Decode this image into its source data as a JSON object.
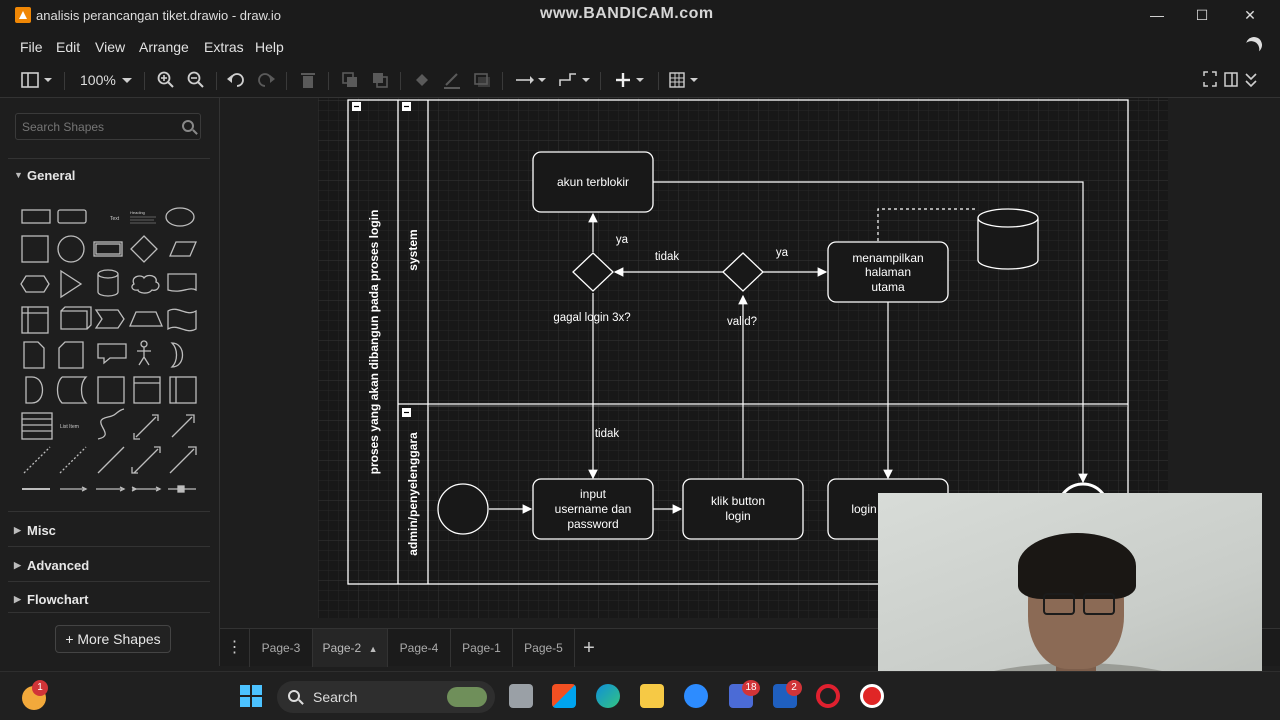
{
  "window": {
    "title": "analisis perancangan tiket.drawio - draw.io",
    "watermark": "www.BANDICAM.com",
    "controls": [
      "—",
      "☐",
      "✕"
    ]
  },
  "menu": [
    "File",
    "Edit",
    "View",
    "Arrange",
    "Extras",
    "Help"
  ],
  "toolbar": {
    "zoom": "100%"
  },
  "sidebar": {
    "search_placeholder": "Search Shapes",
    "sections": [
      "General",
      "Misc",
      "Advanced",
      "Flowchart"
    ],
    "more_shapes": "+ More Shapes",
    "shape_labels": {
      "text": "Text",
      "heading": "Heading",
      "list_item": "List Item"
    }
  },
  "diagram": {
    "pool_title": "proses yang akan dibangun pada proses login",
    "lane_system": "system",
    "lane_admin": "admin/penyelenggara",
    "nodes": {
      "akun_terblokir": "akun terblokir",
      "menampilkan": [
        "menampilkan",
        "halaman",
        "utama"
      ],
      "input": [
        "input",
        "username dan",
        "password"
      ],
      "klik": [
        "klik button",
        "login"
      ],
      "login": "login"
    },
    "labels": {
      "ya1": "ya",
      "tidak1": "tidak",
      "ya2": "ya",
      "gagal": "gagal login 3x?",
      "valid": "valid?",
      "tidak2": "tidak"
    }
  },
  "pages": [
    "Page-3",
    "Page-2",
    "Page-4",
    "Page-1",
    "Page-5"
  ],
  "taskbar": {
    "search": "Search",
    "badges": {
      "weather": "1",
      "teams": "18",
      "launcher": "2"
    }
  },
  "colors": {
    "accent": "#f08705",
    "canvas": "#1e1e1e",
    "stroke": "#ffffff"
  }
}
